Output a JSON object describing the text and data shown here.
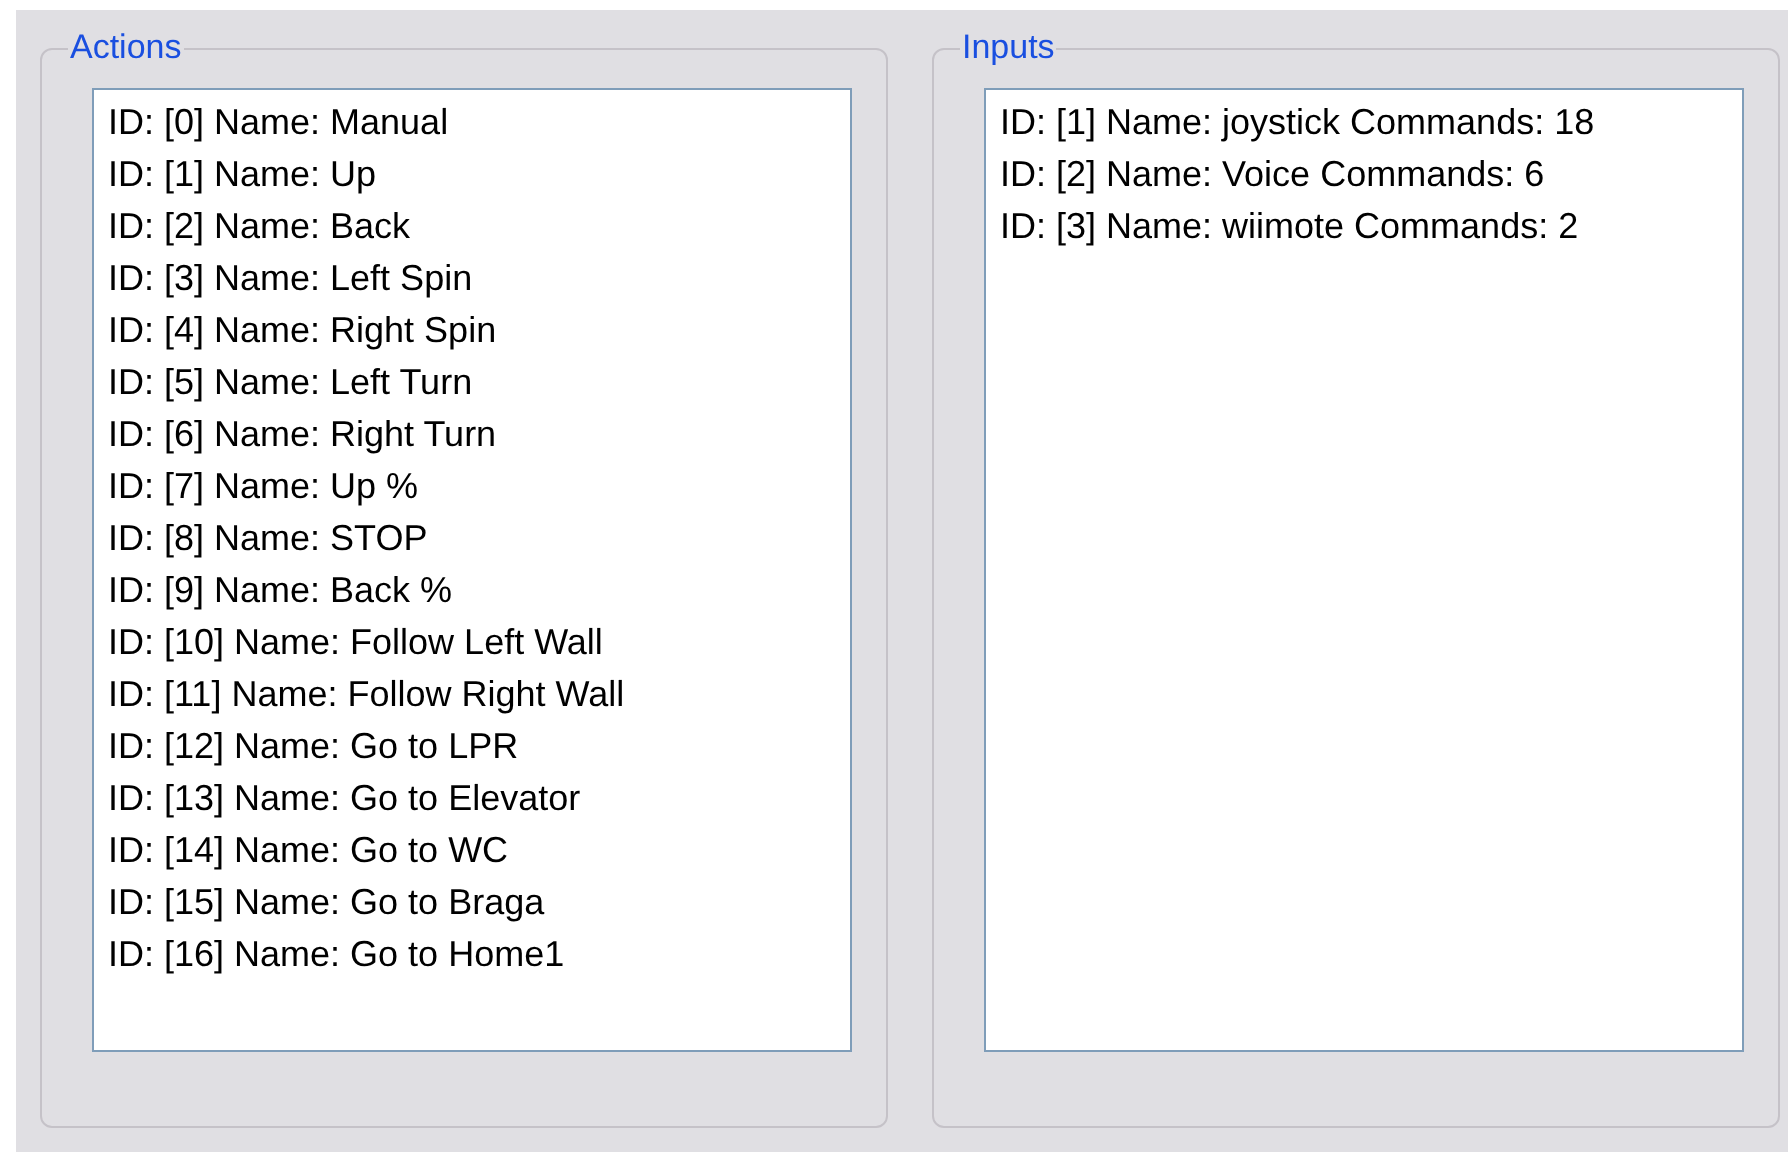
{
  "groups": [
    {
      "title": "Actions",
      "items": [
        "ID: [0] Name: Manual",
        "ID: [1] Name: Up",
        "ID: [2] Name: Back",
        "ID: [3] Name: Left Spin",
        "ID: [4] Name: Right Spin",
        "ID: [5] Name: Left Turn",
        "ID: [6] Name: Right Turn",
        "ID: [7] Name: Up %",
        "ID: [8] Name: STOP",
        "ID: [9] Name: Back %",
        "ID: [10] Name: Follow Left Wall",
        "ID: [11] Name: Follow Right Wall",
        "ID: [12] Name: Go to LPR",
        "ID: [13] Name: Go to Elevator",
        "ID: [14] Name: Go to WC",
        "ID: [15] Name: Go to Braga",
        "ID: [16] Name: Go to Home1"
      ]
    },
    {
      "title": "Inputs",
      "items": [
        "ID: [1] Name: joystick Commands: 18",
        "ID: [2] Name: Voice Commands: 6",
        "ID: [3] Name: wiimote Commands: 2"
      ]
    }
  ]
}
